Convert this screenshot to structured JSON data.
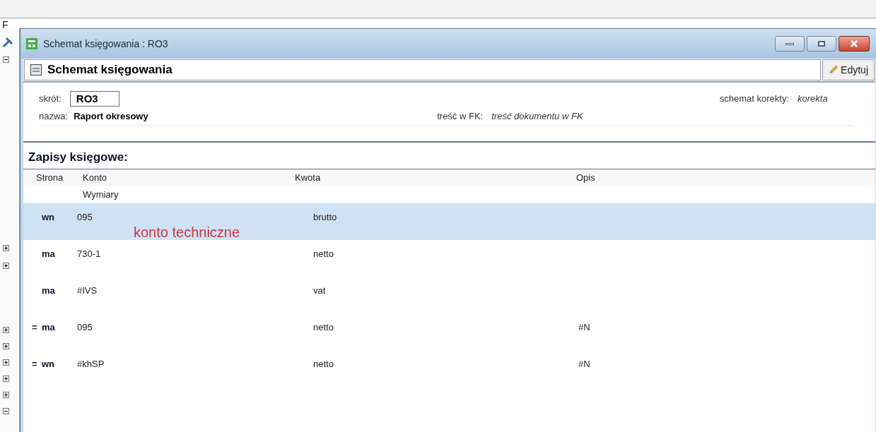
{
  "background_window": {
    "header_text": "F",
    "tree_expanders": [
      {
        "expanded": true
      },
      {
        "expanded": false
      },
      {
        "expanded": false
      },
      {
        "expanded": false
      },
      {
        "expanded": false
      },
      {
        "expanded": false
      },
      {
        "expanded": false
      },
      {
        "expanded": false
      },
      {
        "expanded": true
      }
    ]
  },
  "window": {
    "title": "Schemat księgowania : RO3"
  },
  "toolbar": {
    "title": "Schemat księgowania",
    "edit_button": "Edytuj"
  },
  "form": {
    "short_label": "skrót:",
    "short_value": "RO3",
    "name_label": "nazwa:",
    "name_value": "Raport okresowy",
    "fk_label": "treść w FK:",
    "fk_value": "treść dokumentu w FK",
    "correction_label": "schemat korekty:",
    "correction_value": "korekta"
  },
  "section_title": "Zapisy księgowe:",
  "table": {
    "columns": [
      "Strona",
      "Konto",
      "Kwota",
      "Opis"
    ],
    "subheader": "Wymiary",
    "rows": [
      {
        "prefix": "",
        "side": "wn",
        "account": "095",
        "amount": "brutto",
        "description": "",
        "note": "konto techniczne",
        "selected": true
      },
      {
        "prefix": "",
        "side": "ma",
        "account": "730-1",
        "amount": "netto",
        "description": "",
        "selected": false
      },
      {
        "prefix": "",
        "side": "ma",
        "account": "#IVS",
        "amount": "vat",
        "description": "",
        "selected": false
      },
      {
        "prefix": "=",
        "side": "ma",
        "account": "095",
        "amount": "netto",
        "description": "#N",
        "selected": false
      },
      {
        "prefix": "=",
        "side": "wn",
        "account": "#khSP",
        "amount": "netto",
        "description": "#N",
        "selected": false
      }
    ]
  }
}
